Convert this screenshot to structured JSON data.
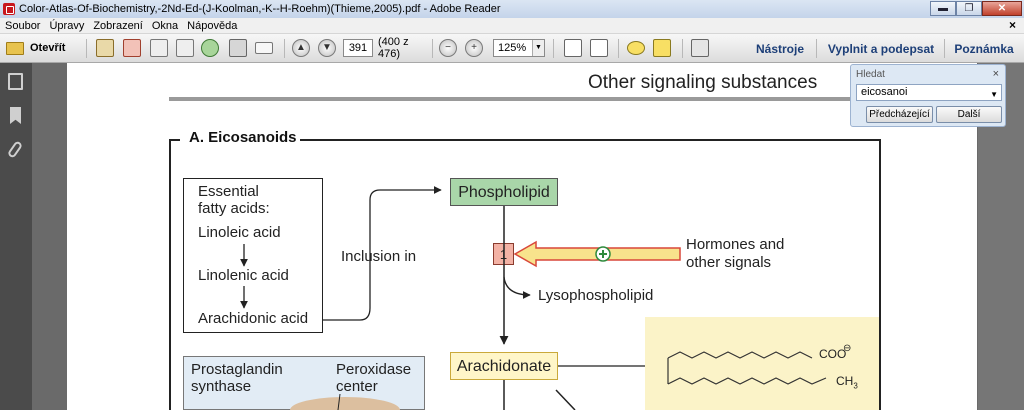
{
  "window": {
    "title": "Color-Atlas-Of-Biochemistry,-2Nd-Ed-(J-Koolman,-K--H-Roehm)(Thieme,2005).pdf - Adobe Reader",
    "minimize": "▬",
    "restore": "❐",
    "close": "✕"
  },
  "menubar": {
    "items": [
      "Soubor",
      "Úpravy",
      "Zobrazení",
      "Okna",
      "Nápověda"
    ],
    "close": "×"
  },
  "toolbar": {
    "open_label": "Otevřít",
    "page_input": "391",
    "page_count": "(400 z 476)",
    "zoom_minus": "−",
    "zoom_plus": "+",
    "zoom_value": "125%",
    "zoom_dropdown": "▼",
    "nastroje": "Nástroje",
    "vyplnit": "Vyplnit a podepsat",
    "poznamka": "Poznámka"
  },
  "find": {
    "label": "Hledat",
    "close": "×",
    "value": "eicosanoi",
    "dropdown": "▼",
    "prev": "Předcházející",
    "next": "Další"
  },
  "document": {
    "section_title": "Other signaling substances",
    "panel_title": "A. Eicosanoids",
    "essential_title_1": "Essential",
    "essential_title_2": "fatty acids:",
    "linoleic": "Linoleic acid",
    "linolenic": "Linolenic acid",
    "arachidonic": "Arachidonic acid",
    "inclusion": "Inclusion in",
    "phospholipid": "Phospholipid",
    "enzyme_num": "1",
    "hormones_1": "Hormones and",
    "hormones_2": "other signals",
    "lysophospholipid": "Lysophospholipid",
    "arachidonate": "Arachidonate",
    "prostaglandin_1": "Prostaglandin",
    "prostaglandin_2": "synthase",
    "peroxidase_1": "Peroxidase",
    "peroxidase_2": "center",
    "coo": "COO",
    "charge": "⊖",
    "ch3": "CH",
    "ch3_sub": "3"
  }
}
